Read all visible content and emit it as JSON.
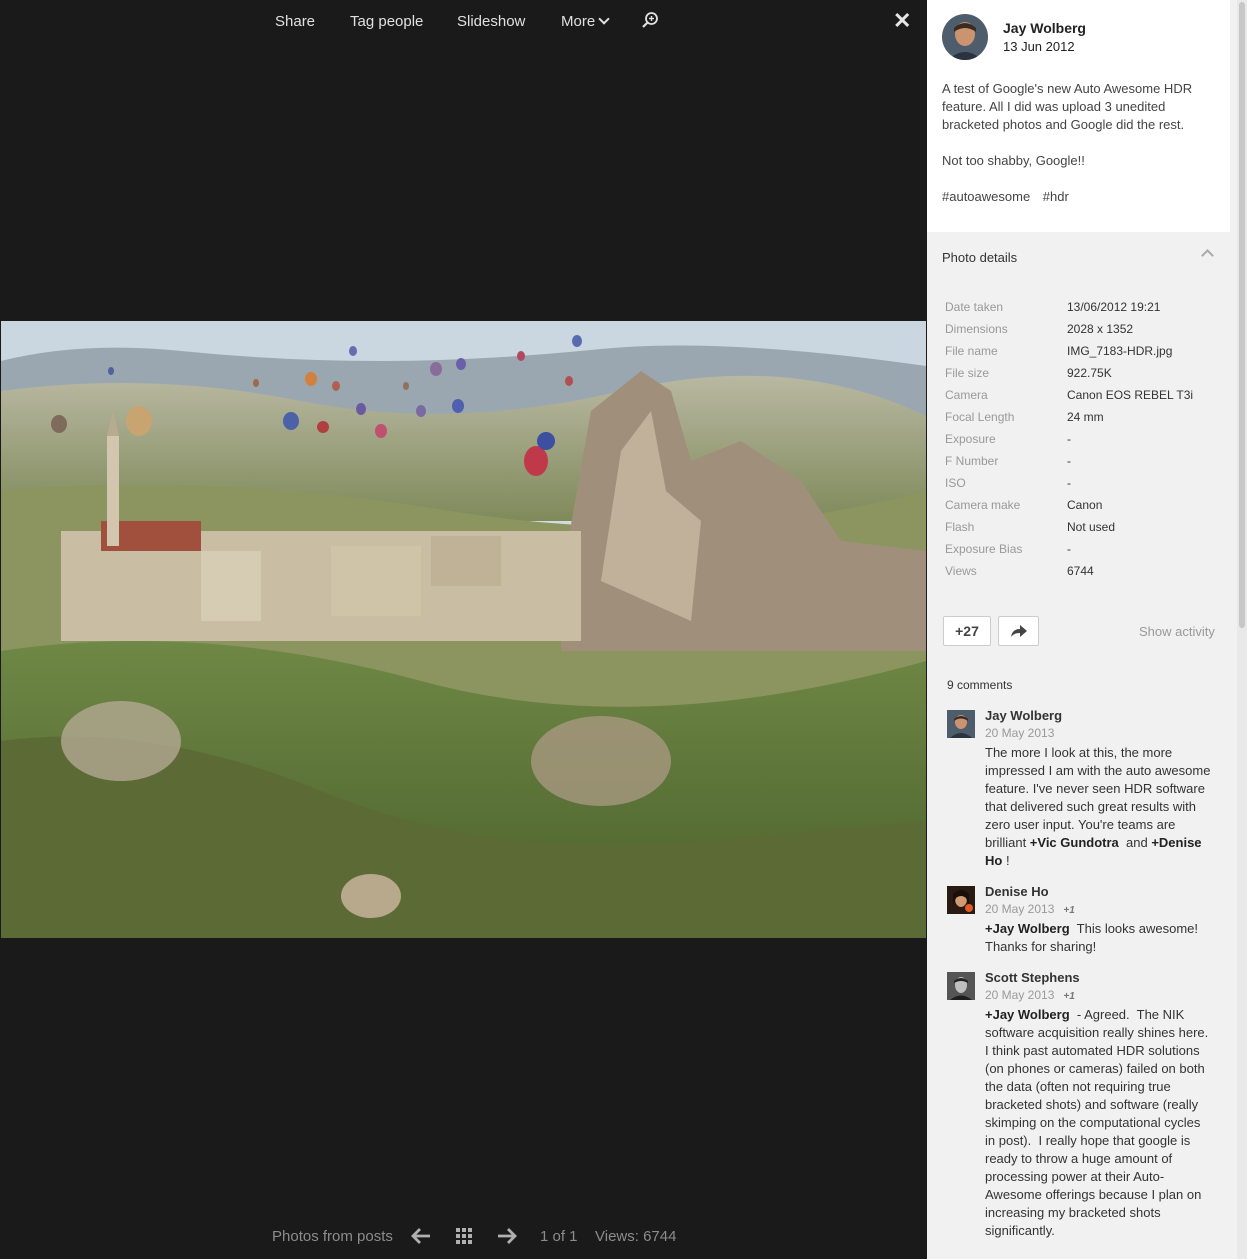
{
  "toolbar": {
    "share": "Share",
    "tag_people": "Tag people",
    "slideshow": "Slideshow",
    "more": "More"
  },
  "bottom": {
    "photos_from_posts": "Photos from posts",
    "counter": "1 of 1",
    "views": "Views: 6744"
  },
  "post": {
    "author": "Jay Wolberg",
    "date": "13 Jun 2012",
    "text_1": "A test of Google's new Auto Awesome HDR feature. All I did was upload 3 unedited bracketed photos and Google did the rest.",
    "text_2": "Not too shabby, Google!!",
    "hashtags": [
      "#autoawesome",
      "#hdr"
    ]
  },
  "details": {
    "title": "Photo details",
    "rows": [
      {
        "label": "Date taken",
        "value": "13/06/2012 19:21"
      },
      {
        "label": "Dimensions",
        "value": "2028 x 1352"
      },
      {
        "label": "File name",
        "value": "IMG_7183-HDR.jpg"
      },
      {
        "label": "File size",
        "value": "922.75K"
      },
      {
        "label": "Camera",
        "value": "Canon EOS REBEL T3i"
      },
      {
        "label": "Focal Length",
        "value": "24 mm"
      },
      {
        "label": "Exposure",
        "value": "-"
      },
      {
        "label": "F Number",
        "value": "-"
      },
      {
        "label": "ISO",
        "value": "-"
      },
      {
        "label": "Camera make",
        "value": "Canon"
      },
      {
        "label": "Flash",
        "value": "Not used"
      },
      {
        "label": "Exposure Bias",
        "value": "-"
      },
      {
        "label": "Views",
        "value": "6744"
      }
    ]
  },
  "actions": {
    "plus_count": "+27",
    "show_activity": "Show activity"
  },
  "comments": {
    "count_label": "9 comments",
    "items": [
      {
        "name": "Jay Wolberg",
        "date": "20 May 2013",
        "plus": "",
        "text_a": "The more I look at this, the more impressed I am with the auto awesome feature. I've never seen HDR software that delivered such great results with zero user input. You're teams are brilliant ",
        "mention_1": "+Vic Gundotra",
        "text_b": "  and ",
        "mention_2": "+Denise Ho",
        "text_c": " !"
      },
      {
        "name": "Denise Ho",
        "date": "20 May 2013",
        "plus": "+1",
        "mention_1": "+Jay Wolberg",
        "text_a": "  This looks awesome! Thanks for sharing!"
      },
      {
        "name": "Scott Stephens",
        "date": "20 May 2013",
        "plus": "+1",
        "mention_1": "+Jay Wolberg",
        "text_a": "  - Agreed.  The NIK software acquisition really shines here.  I think past automated HDR solutions (on phones or cameras) failed on both the data (often not requiring true bracketed shots) and software (really skimping on the computational cycles in post).  I really hope that google is ready to throw a huge amount of processing power at their Auto-Awesome offerings because I plan on increasing my bracketed shots significantly."
      }
    ]
  }
}
